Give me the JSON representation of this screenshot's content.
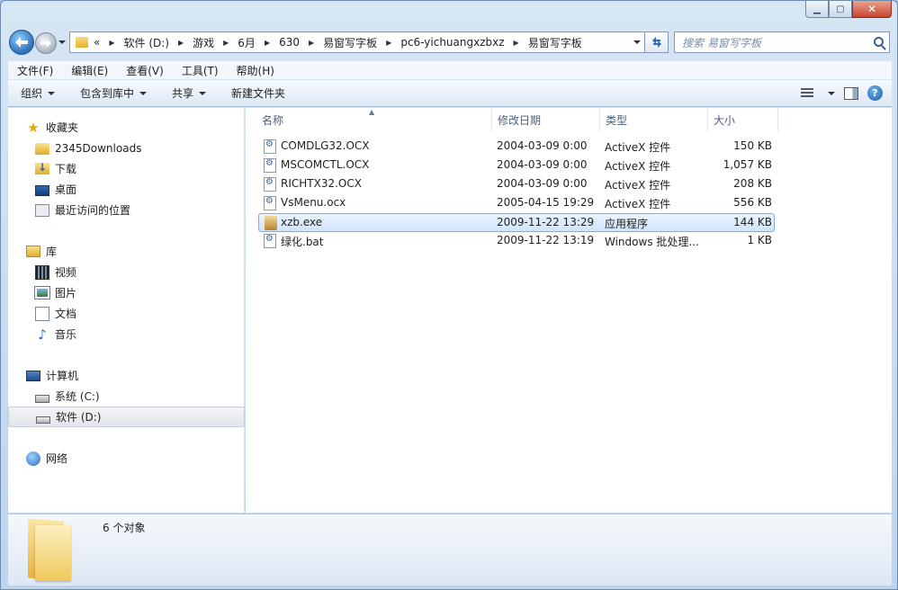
{
  "window": {
    "controls": {
      "minimize": "▁",
      "maximize": "▢",
      "close": "✕"
    }
  },
  "address": {
    "overflow": "«",
    "path": [
      "软件 (D:)",
      "游戏",
      "6月",
      "630",
      "易窗写字板",
      "pc6-yichuangxzbxz",
      "易窗写字板"
    ],
    "search_placeholder": "搜索 易窗写字板"
  },
  "menu": [
    "文件(F)",
    "编辑(E)",
    "查看(V)",
    "工具(T)",
    "帮助(H)"
  ],
  "commands": {
    "organize": "组织",
    "include_library": "包含到库中",
    "share": "共享",
    "new_folder": "新建文件夹",
    "help": "?"
  },
  "nav": {
    "favorites": {
      "label": "收藏夹",
      "items": [
        "2345Downloads",
        "下载",
        "桌面",
        "最近访问的位置"
      ]
    },
    "libraries": {
      "label": "库",
      "items": [
        "视频",
        "图片",
        "文档",
        "音乐"
      ]
    },
    "computer": {
      "label": "计算机",
      "items": [
        "系统 (C:)",
        "软件 (D:)"
      ]
    },
    "network": {
      "label": "网络"
    }
  },
  "columns": {
    "name": "名称",
    "modified": "修改日期",
    "type": "类型",
    "size": "大小",
    "sort_arrow": "▲"
  },
  "files": [
    {
      "name": "COMDLG32.OCX",
      "modified": "2004-03-09 0:00",
      "type": "ActiveX 控件",
      "size": "150 KB"
    },
    {
      "name": "MSCOMCTL.OCX",
      "modified": "2004-03-09 0:00",
      "type": "ActiveX 控件",
      "size": "1,057 KB"
    },
    {
      "name": "RICHTX32.OCX",
      "modified": "2004-03-09 0:00",
      "type": "ActiveX 控件",
      "size": "208 KB"
    },
    {
      "name": "VsMenu.ocx",
      "modified": "2005-04-15 19:29",
      "type": "ActiveX 控件",
      "size": "556 KB"
    },
    {
      "name": "xzb.exe",
      "modified": "2009-11-22 13:29",
      "type": "应用程序",
      "size": "144 KB"
    },
    {
      "name": "绿化.bat",
      "modified": "2009-11-22 13:19",
      "type": "Windows 批处理...",
      "size": "1 KB"
    }
  ],
  "details": {
    "count": "6 个对象"
  }
}
